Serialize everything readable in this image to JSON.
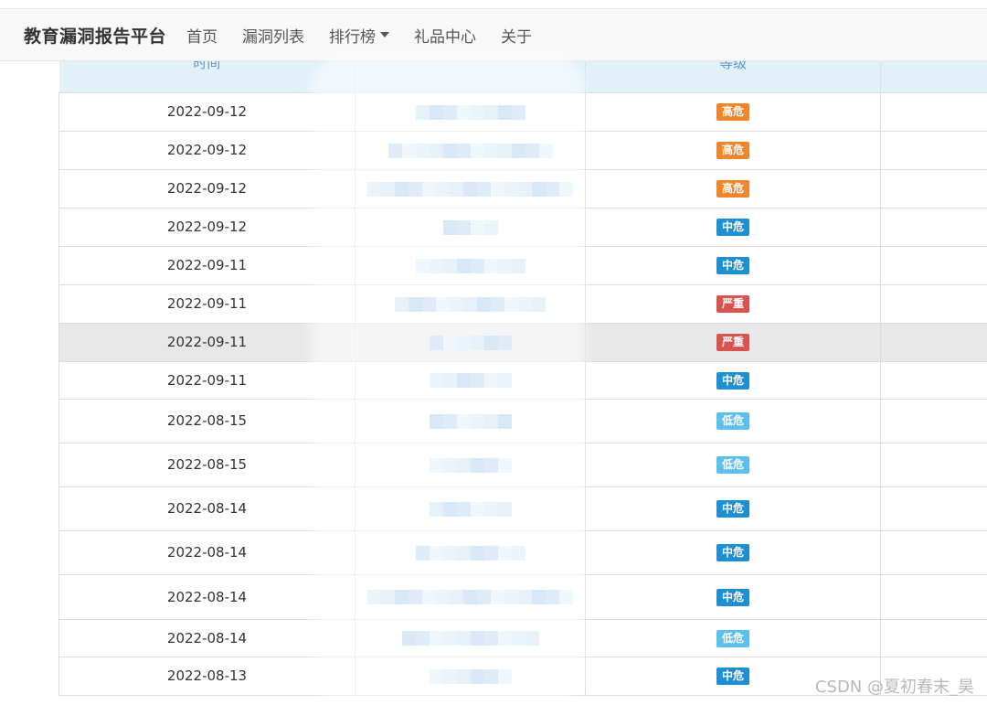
{
  "navbar": {
    "brand": "教育漏洞报告平台",
    "items": [
      {
        "label": "首页",
        "dropdown": false
      },
      {
        "label": "漏洞列表",
        "dropdown": false
      },
      {
        "label": "排行榜",
        "dropdown": true
      },
      {
        "label": "礼品中心",
        "dropdown": false
      },
      {
        "label": "关于",
        "dropdown": false
      }
    ]
  },
  "table": {
    "columns": [
      "时间",
      "",
      "等级",
      ""
    ],
    "rows": [
      {
        "date": "2022-09-12",
        "level": "高危",
        "level_class": "b-high",
        "mosaic": 8
      },
      {
        "date": "2022-09-12",
        "level": "高危",
        "level_class": "b-high",
        "mosaic": 12
      },
      {
        "date": "2022-09-12",
        "level": "高危",
        "level_class": "b-high",
        "mosaic": 15
      },
      {
        "date": "2022-09-12",
        "level": "中危",
        "level_class": "b-mid",
        "mosaic": 4
      },
      {
        "date": "2022-09-11",
        "level": "中危",
        "level_class": "b-mid",
        "mosaic": 8
      },
      {
        "date": "2022-09-11",
        "level": "严重",
        "level_class": "b-crit",
        "mosaic": 11
      },
      {
        "date": "2022-09-11",
        "level": "严重",
        "level_class": "b-crit",
        "mosaic": 6,
        "highlight": true
      },
      {
        "date": "2022-09-11",
        "level": "中危",
        "level_class": "b-mid",
        "mosaic": 6
      },
      {
        "date": "2022-08-15",
        "level": "低危",
        "level_class": "b-low",
        "mosaic": 6
      },
      {
        "date": "2022-08-15",
        "level": "低危",
        "level_class": "b-low",
        "mosaic": 6
      },
      {
        "date": "2022-08-14",
        "level": "中危",
        "level_class": "b-mid",
        "mosaic": 6
      },
      {
        "date": "2022-08-14",
        "level": "中危",
        "level_class": "b-mid",
        "mosaic": 8
      },
      {
        "date": "2022-08-14",
        "level": "中危",
        "level_class": "b-mid",
        "mosaic": 15
      },
      {
        "date": "2022-08-14",
        "level": "低危",
        "level_class": "b-low",
        "mosaic": 10
      },
      {
        "date": "2022-08-13",
        "level": "中危",
        "level_class": "b-mid",
        "mosaic": 6
      }
    ]
  },
  "colors": {
    "high": "#f0862b",
    "medium": "#1e8fd3",
    "low": "#5bc0ee",
    "critical": "#d9534f",
    "header_bg": "#e1f0f9"
  },
  "watermark": "CSDN @夏初春末_昊"
}
